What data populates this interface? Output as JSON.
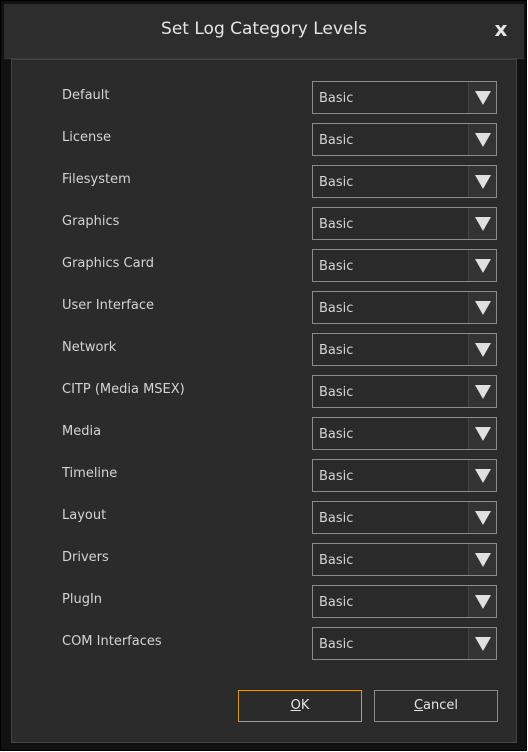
{
  "dialog": {
    "title": "Set Log Category Levels",
    "close_label": "x"
  },
  "categories": [
    {
      "label": "Default",
      "value": "Basic"
    },
    {
      "label": "License",
      "value": "Basic"
    },
    {
      "label": "Filesystem",
      "value": "Basic"
    },
    {
      "label": "Graphics",
      "value": "Basic"
    },
    {
      "label": "Graphics Card",
      "value": "Basic"
    },
    {
      "label": "User Interface",
      "value": "Basic"
    },
    {
      "label": "Network",
      "value": "Basic"
    },
    {
      "label": "CITP (Media MSEX)",
      "value": "Basic"
    },
    {
      "label": "Media",
      "value": "Basic"
    },
    {
      "label": "Timeline",
      "value": "Basic"
    },
    {
      "label": "Layout",
      "value": "Basic"
    },
    {
      "label": "Drivers",
      "value": "Basic"
    },
    {
      "label": "PlugIn",
      "value": "Basic"
    },
    {
      "label": "COM Interfaces",
      "value": "Basic"
    }
  ],
  "buttons": {
    "ok": {
      "mnemonic": "O",
      "rest": "K"
    },
    "cancel": {
      "mnemonic": "C",
      "rest": "ancel"
    }
  },
  "colors": {
    "focus_border": "#d39b2b",
    "panel_bg": "#2b2b2b",
    "titlebar_bg": "#2d2d2d"
  },
  "icons": {
    "close": "close-icon",
    "dropdown": "chevron-down-icon"
  }
}
